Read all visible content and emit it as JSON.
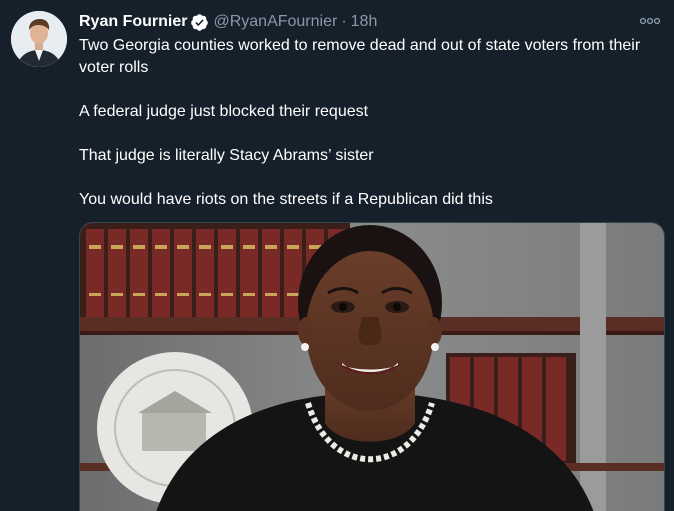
{
  "tweet": {
    "author": {
      "display_name": "Ryan Fournier",
      "handle": "@RyanAFournier",
      "verified": true
    },
    "separator": "·",
    "timestamp": "18h",
    "lines": [
      "Two Georgia counties worked to remove dead and out of state voters from their voter rolls",
      "A federal judge just blocked their request",
      "That judge is literally Stacy Abrams’ sister",
      "You would have riots on the streets if a Republican did this"
    ],
    "media": {
      "kind": "photo"
    }
  },
  "icons": {
    "verified": "verified-badge-icon",
    "more": "more-options-icon"
  },
  "colors": {
    "background": "#15202b",
    "text": "#ffffff",
    "secondary_text": "#8899a6",
    "border": "#38444d",
    "verified": "#ffffff"
  }
}
